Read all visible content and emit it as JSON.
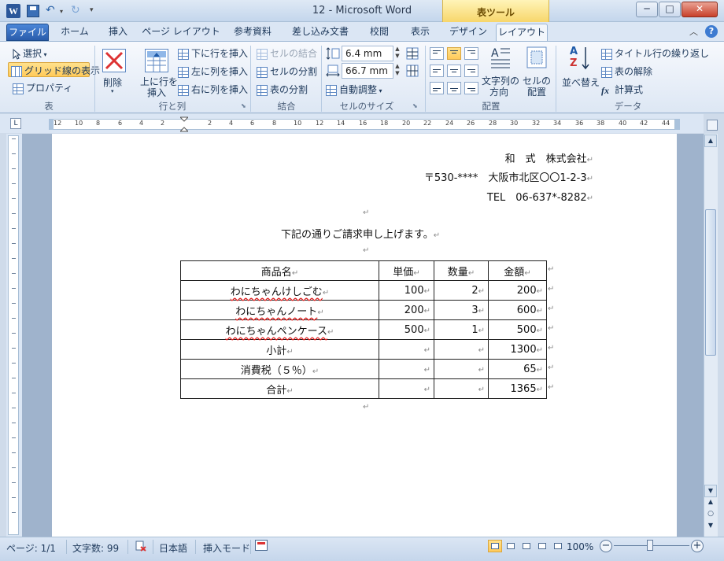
{
  "window": {
    "title": "12 - Microsoft Word",
    "context_group": "表ツール",
    "minimize": "─",
    "maximize": "□",
    "close": "✕"
  },
  "quick_access": {
    "undo": "↶",
    "redo": "↻",
    "more": "▾",
    "undo_drop": "▾"
  },
  "tabs": [
    "ファイル",
    "ホーム",
    "挿入",
    "ページ レイアウト",
    "参考資料",
    "差し込み文書",
    "校閲",
    "表示",
    "デザイン",
    "レイアウト"
  ],
  "active_tab": "レイアウト",
  "ribbon": {
    "table_group": {
      "label": "表",
      "select": "選択",
      "gridlines": "グリッド線の表示",
      "properties": "プロパティ"
    },
    "rows_cols_group": {
      "label": "行と列",
      "delete": "削除",
      "insert_above_1": "上に行を",
      "insert_above_2": "挿入",
      "insert_below": "下に行を挿入",
      "insert_left": "左に列を挿入",
      "insert_right": "右に列を挿入"
    },
    "merge_group": {
      "label": "結合",
      "merge_cells": "セルの結合",
      "split_cells": "セルの分割",
      "split_table": "表の分割"
    },
    "cell_size_group": {
      "label": "セルのサイズ",
      "height": "6.4 mm",
      "width": "66.7 mm",
      "autofit": "自動調整"
    },
    "alignment_group": {
      "label": "配置",
      "text_direction_1": "文字列の",
      "text_direction_2": "方向",
      "cell_margins_1": "セルの",
      "cell_margins_2": "配置"
    },
    "data_group": {
      "label": "データ",
      "sort": "並べ替え",
      "repeat_header": "タイトル行の繰り返し",
      "convert_text": "表の解除",
      "formula": "計算式",
      "az_a": "A",
      "az_z": "Z"
    }
  },
  "ruler": {
    "toggle": "L",
    "ticks": [
      "12",
      "10",
      "8",
      "6",
      "4",
      "2",
      "2",
      "4",
      "6",
      "8",
      "10",
      "12",
      "14",
      "16",
      "18",
      "20",
      "22",
      "24",
      "26",
      "28",
      "30",
      "32",
      "34",
      "36",
      "38",
      "40",
      "42",
      "44"
    ]
  },
  "document": {
    "company": "和　式　株式会社",
    "address": "〒530-****　大阪市北区〇〇1-2-3",
    "tel": "TEL　06-637*-8282",
    "intro": "下記の通りご請求申し上げます。",
    "para_mark": "↵",
    "table": {
      "headers": [
        "商品名",
        "単価",
        "数量",
        "金額"
      ],
      "rows": [
        [
          "わにちゃんけしごむ",
          "100",
          "2",
          "200"
        ],
        [
          "わにちゃんノート",
          "200",
          "3",
          "600"
        ],
        [
          "わにちゃんペンケース",
          "500",
          "1",
          "500"
        ],
        [
          "小計",
          "",
          "",
          "1300"
        ],
        [
          "消費税（５％）",
          "",
          "",
          "65"
        ],
        [
          "合計",
          "",
          "",
          "1365"
        ]
      ]
    }
  },
  "status": {
    "page": "ページ: 1/1",
    "words": "文字数: 99",
    "language": "日本語",
    "mode": "挿入モード",
    "zoom": "100%",
    "zoom_minus": "−",
    "zoom_plus": "+"
  },
  "scroll": {
    "up": "▲",
    "down": "▼",
    "prev": "▲",
    "next": "▼",
    "browse": "○"
  },
  "colors": {
    "file_tab": "#2a5cab",
    "context_tab": "#f7d66b",
    "accent": "#ffca5a"
  }
}
